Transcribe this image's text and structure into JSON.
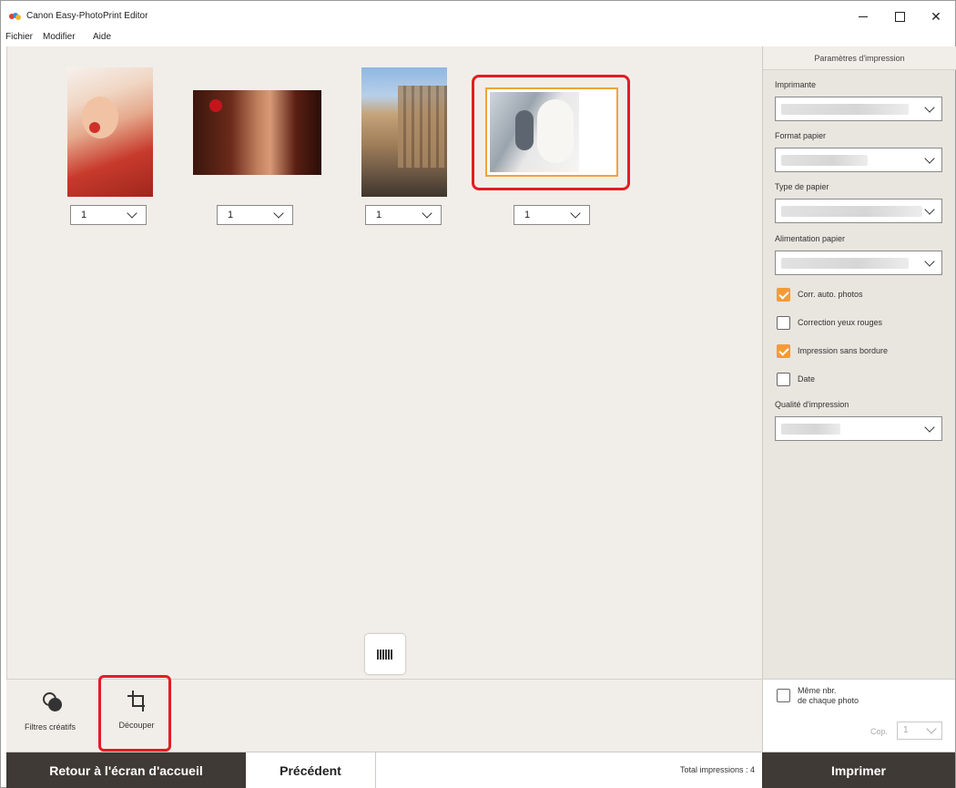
{
  "window": {
    "title": "Canon Easy-PhotoPrint Editor",
    "minimize": "",
    "maximize": "",
    "close": "✕"
  },
  "menu": [
    "Fichier",
    "Modifier",
    "Aide"
  ],
  "photos": [
    {
      "quantity": "1"
    },
    {
      "quantity": "1"
    },
    {
      "quantity": "1"
    },
    {
      "quantity": "1",
      "selected": true
    }
  ],
  "toolbar": {
    "filters_label": "Filtres créatifs",
    "crop_label": "Découper"
  },
  "actions": {
    "home_label": "Retour à l'écran d'accueil",
    "prev_label": "Précédent",
    "total": "Total impressions : 4",
    "print_label": "Imprimer"
  },
  "panel": {
    "header": "Paramètres d'impression",
    "printer_label": "Imprimante",
    "paper_size_label": "Format papier",
    "paper_type_label": "Type de papier",
    "paper_source_label": "Alimentation papier",
    "checkboxes": [
      {
        "label": "Corr. auto. photos",
        "checked": true
      },
      {
        "label": "Correction yeux rouges",
        "checked": false
      },
      {
        "label": "Impression sans bordure",
        "checked": true
      },
      {
        "label": "Date",
        "checked": false
      }
    ],
    "quality_label": "Qualité d'impression",
    "same_count_line1": "Même nbr.",
    "same_count_line2": "de chaque photo",
    "copies_label": "Cop.",
    "copies_value": "1"
  },
  "colors": {
    "accent": "#f29c38",
    "highlight": "#e21d24",
    "dark_button": "#3f3a35",
    "canvas": "#f1eee9"
  }
}
